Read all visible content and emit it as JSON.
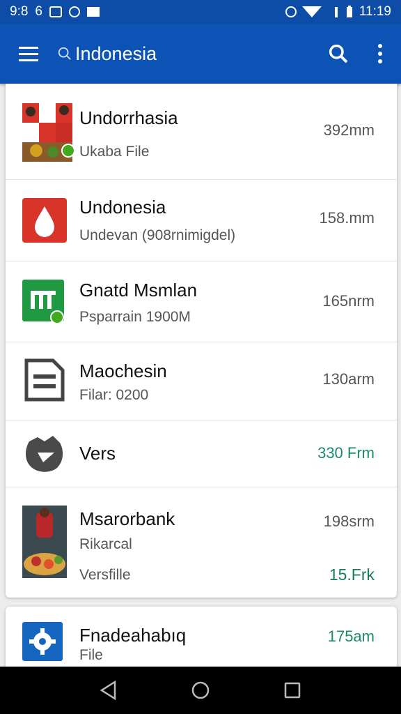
{
  "status_bar": {
    "time_left": "9:8",
    "carrier_glyph": "6",
    "time_right": "11:19"
  },
  "app_bar": {
    "query": "Indonesia",
    "icons": [
      "menu-icon",
      "search-icon",
      "more-vert-icon"
    ]
  },
  "items": [
    {
      "title": "Undorrhasia",
      "subtitle": "Ukaba File",
      "size": "392mm",
      "icon": "photo-collage-icon"
    },
    {
      "title": "Undonesia",
      "subtitle": "Undevan (908rnimigdel)",
      "size": "158.mm",
      "icon": "red-drop-app-icon"
    },
    {
      "title": "Gnatd Msmlan",
      "subtitle": "Psparrain 1900M",
      "size": "165nrm",
      "icon": "green-sheets-app-icon"
    },
    {
      "title": "Maochesin",
      "subtitle": "Filar: 0200",
      "size": "130arm",
      "icon": "document-file-icon"
    },
    {
      "title": "Vers",
      "subtitle": "",
      "size": "330 Frm",
      "icon": "gray-blob-icon"
    },
    {
      "title": "Msarorbank",
      "subtitle": "Rikarcal",
      "subtitle2": "Versfille",
      "size": "198srm",
      "size2": "15.Frk",
      "icon": "food-photo-icon"
    }
  ],
  "card2": {
    "title": "Fnadeahabıq",
    "subtitle": "File",
    "size": "175am",
    "icon": "settings-gear-icon"
  },
  "colors": {
    "app_bar": "#0d53b5",
    "status_bar": "#0d4da8",
    "accent_green": "#1a8a6c"
  },
  "nav": [
    "back-icon",
    "home-icon",
    "recents-icon"
  ]
}
